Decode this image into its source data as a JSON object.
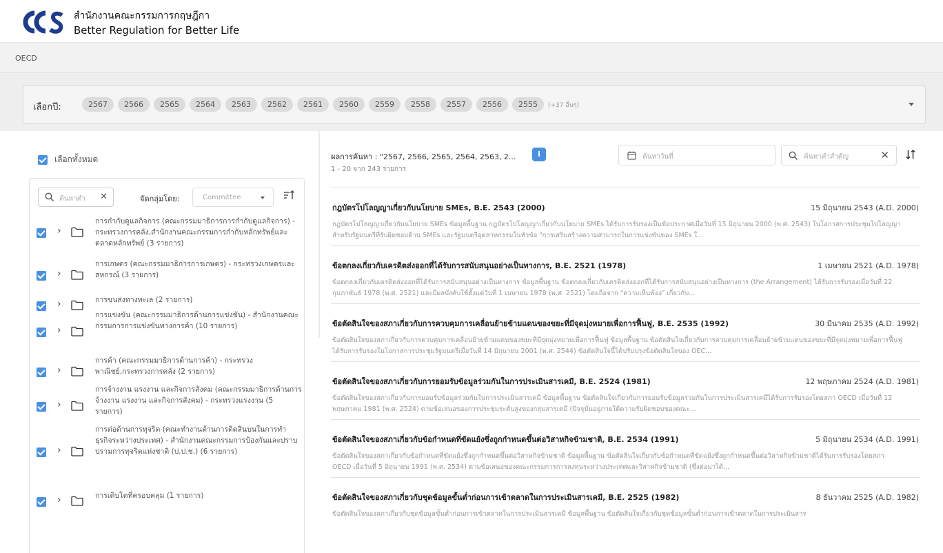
{
  "header": {
    "logo_text": "OCS",
    "brand_th": "สำนักงานคณะกรรมการกฤษฎีกา",
    "brand_en": "Better Regulation for Better Life"
  },
  "breadcrumb": "OECD",
  "year_filter": {
    "label": "เลือกปี:",
    "chips": [
      "2567",
      "2566",
      "2565",
      "2564",
      "2563",
      "2562",
      "2561",
      "2560",
      "2559",
      "2558",
      "2557",
      "2556",
      "2555"
    ],
    "more": "(+37 อื่นๆ)"
  },
  "left": {
    "select_all": "เลือกทั้งหมด",
    "search_placeholder": "ค้นหาคำ",
    "group_label": "จัดกลุ่มโดย:",
    "group_value": "Committee",
    "tree": [
      "การกำกับดูแลกิจการ (คณะกรรมมาธิการการกำกับดูแลกิจการ) - กระทรวงการคลัง,สำนักงานคณะกรรมการกำกับหลักทรัพย์และตลาดหลักทรัพย์ (3 รายการ)",
      "การเกษตร (คณะกรรมมาธิการการเกษตร) - กระทรวงเกษตรและสหกรณ์ (3 รายการ)",
      "การขนส่งทางทะเล (2 รายการ)",
      "การแข่งขัน (คณะกรรมมาธิการด้านการแข่งขัน) - สำนักงานคณะกรรมการการแข่งขันทางการค้า (10 รายการ)",
      "การค้า (คณะกรรมมาธิการด้านการค้า) - กระทรวงพาณิชย์,กระทรวงการคลัง (2 รายการ)",
      "การจ้างงาน แรงงาน และกิจการสังคม (คณะกรรมมาธิการด้านการจ้างงาน แรงงาน และกิจการสังคม) - กระทรวงแรงงาน (5 รายการ)",
      "การต่อต้านการทุจริต (คณะทำงานด้านการติดสินบนในการทำธุรกิจระหว่างประเทศ) - สำนักงานคณะกรรมการป้องกันและปราบปรามการทุจริตแห่งชาติ (ป.ป.ช.) (6 รายการ)",
      "การเติบโตที่ครอบคลุม (1 รายการ)"
    ]
  },
  "right": {
    "result_title": "ผลการค้นหา : \"2567, 2566, 2565, 2564, 2563, 2...",
    "result_count": "1 - 20 จาก 243 รายการ",
    "info_label": "i",
    "date_placeholder": "ค้นหาวันที่",
    "keyword_placeholder": "ค้นหาคำสำคัญ",
    "results": [
      {
        "title": "กฎบัตรโปโลญญาเกี่ยวกับนโยบาย SMEs, B.E. 2543 (2000)",
        "date": "15 มิถุนายน 2543 (A.D. 2000)",
        "snippet": "กฎบัตรโปโลญญาเกี่ยวกับนโยบาย SMEs ข้อมูลพื้นฐาน กฎบัตรโปโลญญาเกี่ยวกับนโยบาย SMEs ได้รับการรับรองเป็นข้อประกาศเมื่อวันที่ 15 มิถุนายน 2000 (พ.ศ. 2543) ในโอกาสการประชุมโปโลญญาสำหรับรัฐมนตรีที่รับผิดชอบด้าน SMEs และรัฐมนตรีอุตสาหกรรมในหัวข้อ \"การเสริมสร้างความสามารถในการแข่งขันของ SMEs ใ..."
      },
      {
        "title": "ข้อตกลงเกี่ยวกับเครดิตส่งออกที่ได้รับการสนับสนุนอย่างเป็นทางการ, B.E. 2521 (1978)",
        "date": "1 เมษายน 2521 (A.D. 1978)",
        "snippet": "ข้อตกลงเกี่ยวกับเครดิตส่งออกที่ได้รับการสนับสนุนอย่างเป็นทางการ ข้อมูลพื้นฐาน ข้อตกลงเกี่ยวกับเครดิตส่งออกที่ได้รับการสนับสนุนอย่างเป็นทางการ (the Arrangement) ได้รับการรับรองเมื่อวันที่ 22 กุมภาพันธ์ 1978 (พ.ศ. 2521) และมีผลบังคับใช้ตั้งแต่วันที่ 1 เมษายน 1978 (พ.ศ. 2521) โดยถือจาก \"ความเห็นพ้อง\" เกี่ยวกับ..."
      },
      {
        "title": "ข้อตัดสินใจของสภาเกี่ยวกับการควบคุมการเคลื่อนย้ายข้ามแดนของขยะที่มีจุดมุ่งหมายเพื่อการฟื้นฟู, B.E. 2535 (1992)",
        "date": "30 มีนาคม 2535 (A.D. 1992)",
        "snippet": "ข้อตัดสินใจของสภาเกี่ยวกับการควบคุมการเคลื่อนย้ายข้ามแดนของขยะที่มีจุดมุ่งหมายเพื่อการฟื้นฟู ข้อมูลพื้นฐาน ข้อตัดสินใจเกี่ยวกับการควบคุมการเคลื่อนย้ายข้ามแดนของขยะที่มีจุดมุ่งหมายเพื่อการฟื้นฟู ได้รับการรับรองในโอกาสการประชุมรัฐมนตรีเมื่อวันที่ 14 มิถุนายน 2001 (พ.ศ. 2544) ข้อตัดสินใจนี้ได้ปรับปรุงข้อตัดสินใจของ OEC..."
      },
      {
        "title": "ข้อตัดสินใจของสภาเกี่ยวกับการยอมรับข้อมูลร่วมกันในการประเมินสารเคมี, B.E. 2524 (1981)",
        "date": "12 พฤษภาคม 2524 (A.D. 1981)",
        "snippet": "ข้อตัดสินใจของสภาเกี่ยวกับการยอมรับข้อมูลร่วมกันในการประเมินสารเคมี ข้อมูลพื้นฐาน ข้อตัดสินใจเกี่ยวกับการยอมรับข้อมูลร่วมกันในการประเมินสารเคมีได้รับการรับรองโดยสภา OECD เมื่อวันที่ 12 พฤษภาคม 1981 (พ.ศ. 2524) ตามข้อเสนอของการประชุมระดับสูงของกลุ่มสารเคมี (ปัจจุบันอยู่ภายใต้ความรับผิดชอบของคณะ..."
      },
      {
        "title": "ข้อตัดสินใจของสภาเกี่ยวกับข้อกำหนดที่ขัดแย้งซึ่งถูกกำหนดขึ้นต่อวิสาหกิจข้ามชาติ, B.E. 2534 (1991)",
        "date": "5 มิถุนายน 2534 (A.D. 1991)",
        "snippet": "ข้อตัดสินใจของสภาเกี่ยวกับข้อกำหนดที่ขัดแย้งซึ่งถูกกำหนดขึ้นต่อวิสาหกิจข้ามชาติ ข้อมูลพื้นฐาน ข้อตัดสินใจเกี่ยวกับข้อกำหนดที่ขัดแย้งซึ่งถูกกำหนดขึ้นต่อวิสาหกิจข้ามชาติได้รับการรับรองโดยสภา OECD เมื่อวันที่ 5 มิถุนายน 1991 (พ.ศ. 2534) ตามข้อเสนอของคณะกรรมการการลงทุนระหว่างประเทศและวิสาหกิจข้ามชาติ (ซึ่งต่อมาได้..."
      },
      {
        "title": "ข้อตัดสินใจของสภาเกี่ยวกับชุดข้อมูลขั้นต่ำก่อนการเข้าตลาดในการประเมินสารเคมี, B.E. 2525 (1982)",
        "date": "8 ธันวาคม 2525 (A.D. 1982)",
        "snippet": "ข้อตัดสินใจของสภาเกี่ยวกับชุดข้อมูลขั้นต่ำก่อนการเข้าตลาดในการประเมินสารเคมี ข้อมูลพื้นฐาน ข้อตัดสินใจเกี่ยวกับชุดข้อมูลขั้นต่ำก่อนการเข้าตลาดในการประเมินสาร"
      }
    ]
  },
  "colors": {
    "accent": "#4a90e2",
    "logo": "#1f3c8c"
  }
}
